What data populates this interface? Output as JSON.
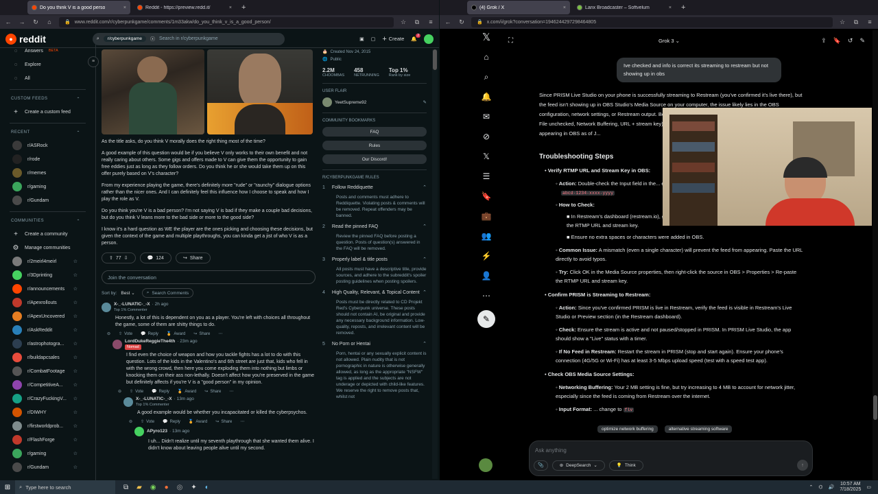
{
  "left": {
    "tabs": [
      {
        "title": "Do you think V is a good perso",
        "active": true,
        "color": "#ff4500"
      },
      {
        "title": "Reddit - https://preview.redd.it/",
        "active": false,
        "color": "#ff4500"
      }
    ],
    "url": "www.reddit.com/r/cyberpunkgame/comments/1m33akw/do_you_think_v_is_a_good_person/",
    "logo": "reddit",
    "search_chip": "r/cyberpunkgame",
    "search_placeholder": "Search in r/cyberpunkgame",
    "create": "Create",
    "notif_count": "2",
    "sidebar": {
      "top_items": [
        {
          "label": "Answers",
          "badge": "BETA",
          "icon": "answers-icon"
        },
        {
          "label": "Explore",
          "icon": "explore-icon"
        },
        {
          "label": "All",
          "icon": "all-icon"
        }
      ],
      "custom_feeds_header": "CUSTOM FEEDS",
      "create_feed": "Create a custom feed",
      "recent_header": "RECENT",
      "recent": [
        {
          "name": "r/ASRock",
          "color": "#3a3a3a"
        },
        {
          "name": "r/rode",
          "color": "#222"
        },
        {
          "name": "r/memes",
          "color": "#6b5a2a"
        },
        {
          "name": "r/gaming",
          "color": "#3ba55c"
        },
        {
          "name": "r/Gundam",
          "color": "#4a4a4a"
        }
      ],
      "communities_header": "COMMUNITIES",
      "create_community": "Create a community",
      "manage_communities": "Manage communities",
      "communities": [
        {
          "name": "r/2meirl4meirl",
          "color": "#7a7a7a"
        },
        {
          "name": "r/3Dprinting",
          "color": "#46d160"
        },
        {
          "name": "r/announcements",
          "color": "#ff4500"
        },
        {
          "name": "r/Apexrollouts",
          "color": "#c0392b"
        },
        {
          "name": "r/ApexUncovered",
          "color": "#e67e22"
        },
        {
          "name": "r/AskReddit",
          "color": "#2980b9"
        },
        {
          "name": "r/astrophotogra...",
          "color": "#2c3e50"
        },
        {
          "name": "r/buildapcsales",
          "color": "#e74c3c"
        },
        {
          "name": "r/CombatFootage",
          "color": "#555"
        },
        {
          "name": "r/CompetitiveA...",
          "color": "#8e44ad"
        },
        {
          "name": "r/CrazyFuckingV...",
          "color": "#16a085"
        },
        {
          "name": "r/DIWHY",
          "color": "#d35400"
        },
        {
          "name": "r/firstworldprob...",
          "color": "#7f8c8d"
        },
        {
          "name": "r/FlashForge",
          "color": "#c0392b"
        },
        {
          "name": "r/gaming",
          "color": "#3ba55c"
        },
        {
          "name": "r/Gundam",
          "color": "#4a4a4a"
        }
      ]
    },
    "post": {
      "body": [
        "As the title asks, do you think V morally does the right thing most of the time?",
        "A good example of this question would be if you believe V only works to their own benefit and not really caring about others. Some gigs and offers made to V can give them the opportunity to gain free eddies just as long as they follow orders. Do you think he or she would take them up on this offer purely based on V's character?",
        "From my experience playing the game, there's definitely more \"rude\" or \"raunchy\" dialogue options rather than the nicer ones. And I can definitely feel this influence how I choose to speak and how I play the role as V.",
        "Do you think you're V is a bad person? I'm not saying V is bad if they make a couple bad decisions, but do you think V leans more to the bad side or more to the good side?",
        "I know it's a hard question as WE the player are the ones picking and choosing these decisions, but given the context of the game and multiple playthroughs, you can kinda get a jist of who V is as a person."
      ],
      "votes": "77",
      "comments": "124",
      "share": "Share",
      "join": "Join the conversation",
      "sort_label": "Sort by:",
      "sort_value": "Best",
      "search_comments": "Search Comments"
    },
    "comments": [
      {
        "author": "X-_-LUNATIC-_-X",
        "time": "· 2h ago",
        "flair": "Top 1% Commenter",
        "text": "Honestly, a lot of this is dependent on you as a player. You're left with choices all throughout the game, some of them are shitty things to do.",
        "vote": "Vote",
        "reply": "Reply",
        "award": "Award",
        "share": "Share"
      },
      {
        "author": "LordDukeReggieThe4th",
        "time": "· 23m ago",
        "flair": "Nomad",
        "text": "I find even the choice of weapon and how you tackle fights has a lot to do with this question. Lots of the kids in the Valentino's and 6th street are just that, kids who fell in with the wrong crowd, then here you come exploding them into nothing but limbs or knocking them on their ass non-lethally. Doesn't affect how you're preserved in the game but definitely affects if you're V is a \"good person\" in my opinion.",
        "vote": "Vote",
        "reply": "Reply",
        "award": "Award",
        "share": "Share"
      },
      {
        "author": "X-_-LUNATIC-_-X",
        "time": "· 13m ago",
        "flair": "Top 1% Commenter",
        "text": "A good example would be whether you incapacitated or killed the cyberpsychos.",
        "vote": "Vote",
        "reply": "Reply",
        "award": "Award",
        "share": "Share"
      },
      {
        "author": "APyro123",
        "time": "· 13m ago",
        "flair": "",
        "text": "I uh... Didn't realize until my seventh playthrough that she wanted them alive. I didn't know about leaving people alive until my second.",
        "vote": "",
        "reply": "",
        "award": "",
        "share": ""
      }
    ],
    "right": {
      "created": "Created Nov 24, 2015",
      "public": "Public",
      "stats": [
        {
          "value": "2.2M",
          "label": "CHOOMBAS"
        },
        {
          "value": "458",
          "label": "NETRUNNING"
        },
        {
          "value": "Top 1%",
          "label": "Rank by size"
        }
      ],
      "user_flair_header": "USER FLAIR",
      "user_flair": "YeetSupreme92",
      "bookmarks_header": "COMMUNITY BOOKMARKS",
      "bookmarks": [
        "FAQ",
        "Rules",
        "Our Discord!"
      ],
      "rules_header": "R/CYBERPUNKGAME RULES",
      "rules": [
        {
          "n": "1",
          "title": "Follow Reddiquette",
          "text": "Posts and comments must adhere to Reddiquette. Violating posts & comments will be removed. Repeat offenders may be banned."
        },
        {
          "n": "2",
          "title": "Read the pinned FAQ",
          "text": "Review the pinned FAQ before posting a question. Posts of question(s) answered in the FAQ will be removed."
        },
        {
          "n": "3",
          "title": "Properly label & title posts",
          "text": "All posts must have a descriptive title, provide sources, and adhere to the subreddit's spoiler posting guidelines when posting spoilers."
        },
        {
          "n": "4",
          "title": "High Quality, Relevant, & Topical Content",
          "text": "Posts must be directly related to CD Projekt Red's Cyberpunk universe. These posts should not contain AI, be original and provide any necessary background information. Low-quality, reposts, and irrelevant content will be removed."
        },
        {
          "n": "5",
          "title": "No Porn or Hentai",
          "text": "Porn, hentai or any sexually explicit content is not allowed. Plain nudity that is not pornographic in nature is otherwise generally allowed, as long as the appropriate \"NSFW\" tag is applied and the subjects are not underage or depicted with child-like features. We reserve the right to remove posts that, whilst not"
        }
      ]
    }
  },
  "rightwin": {
    "tabs": [
      {
        "title": "(4) Grok / X",
        "active": true,
        "color": "#000"
      },
      {
        "title": "Lanx Broadcaster – Softvelum",
        "active": false,
        "color": "#7ac142"
      }
    ],
    "url": "x.com/i/grok?conversation=1946244297298464805",
    "header_title": "Grok 3",
    "user_msg": "Ive checked and info is correct its streaming to restream but not showing up in obs",
    "intro": "Since PRISM Live Studio on your phone is successfully streaming to Restream (you've confirmed it's live there), but the feed isn't showing up in OBS Studio's Media Source on your computer, the issue likely lies in the OBS configuration, network settings, or Restream output. Below are steps to troubleshoot the Media Source with Local File unchecked, Network Buffering, URL + stream key), Input Format (flv), and Reco... resolve why the feed isn't appearing in OBS as of J...",
    "h_troubleshoot": "Troubleshooting Steps",
    "s1": "Verify RTMP URL and Stream Key in OBS:",
    "s1_action_label": "Action:",
    "s1_action": "Double-check the Input field in the... exact RTMP URL and stream key you used...",
    "s1_code": "abcd-1234-xxxx-yyyy",
    "howto": "How to Check:",
    "howto_1": "In Restream's dashboard (restream.io), go to Settings > Streaming Setup > Custom RTMP and copy the RTMP URL and stream key.",
    "howto_2": "Ensure no extra spaces or characters were added in OBS.",
    "common_label": "Common Issue:",
    "common": "A mismatch (even a single character) will prevent the feed from appearing. Paste the URL directly to avoid typos.",
    "try_label": "Try:",
    "try": "Click OK in the Media Source properties, then right-click the source in OBS > Properties > Re-paste the RTMP URL and stream key.",
    "s2": "Confirm PRISM is Streaming to Restream:",
    "s2_action_label": "Action:",
    "s2_action": "Since you've confirmed PRISM is live in Restream, verify the feed is visible in Restream's Live Studio or Preview section (in the Restream dashboard).",
    "check_label": "Check:",
    "check": "Ensure the stream is active and not paused/stopped in PRISM. In PRISM Live Studio, the app should show a \"Live\" status with a timer.",
    "nofeed_label": "If No Feed in Restream:",
    "nofeed": "Restart the stream in PRISM (stop and start again). Ensure your phone's connection (4G/5G or Wi-Fi) has at least 3-5 Mbps upload speed (test with a speed test app).",
    "s3": "Check OBS Media Source Settings:",
    "nb_label": "Networking Buffering:",
    "nb": "Your 2 MB setting is fine, but try increasing to 4 MB to account for network jitter, especially since the feed is coming from Restream over the internet.",
    "if_label": "Input Format:",
    "if_tail": "change to",
    "if_code": "flv",
    "suggestions": [
      "optimize network buffering",
      "alternative streaming software"
    ],
    "ask_placeholder": "Ask anything",
    "deepsearch": "DeepSearch",
    "think": "Think"
  },
  "taskbar": {
    "search": "Type here to search",
    "time": "10:57 AM",
    "date": "7/18/2025"
  }
}
